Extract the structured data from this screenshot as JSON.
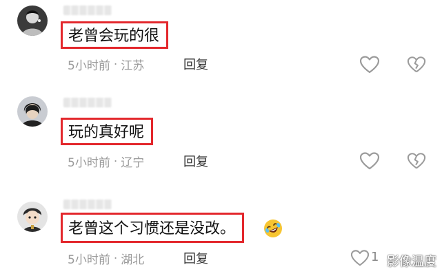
{
  "comments": [
    {
      "username_redacted": true,
      "text": "老曾会玩的很",
      "time": "5小时前",
      "separator": "·",
      "location": "江苏",
      "reply_label": "回复"
    },
    {
      "username_redacted": true,
      "text": "玩的真好呢",
      "time": "5小时前",
      "separator": "·",
      "location": "辽宁",
      "reply_label": "回复"
    },
    {
      "username_redacted": true,
      "text": "老曾这个习惯还是没改。",
      "time": "5小时前",
      "separator": "·",
      "location": "湖北",
      "reply_label": "回复",
      "like_count": "1",
      "emoji": "rolling-on-floor-laughing-icon"
    }
  ],
  "watermark": {
    "text": "影像温度"
  },
  "colors": {
    "highlight_border": "#e3272c",
    "meta_text": "#9a9a9a",
    "comment_text": "#111111",
    "icon_stroke": "#9b9b9b"
  },
  "icons": {
    "like": "heart-outline-icon",
    "dislike": "broken-heart-outline-icon"
  }
}
